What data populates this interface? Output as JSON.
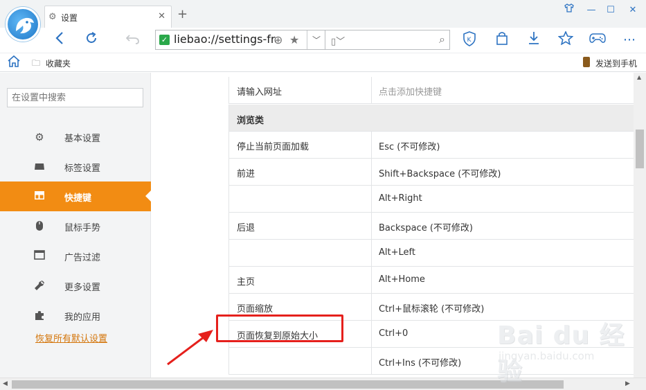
{
  "browser": {
    "tab_title": "设置",
    "tab_close": "✕",
    "new_tab": "+",
    "url": "liebao://settings-frame/shortcuts",
    "search_placeholder": "",
    "window_controls": [
      "shirt-icon",
      "minimize-icon",
      "maximize-icon",
      "close-icon"
    ]
  },
  "bookmarks": {
    "favorites_label": "收藏夹",
    "send_to_phone_label": "发送到手机"
  },
  "sidebar": {
    "search_placeholder": "在设置中搜索",
    "items": [
      {
        "label": "基本设置",
        "icon": "gear-icon"
      },
      {
        "label": "标签设置",
        "icon": "tab-icon"
      },
      {
        "label": "快捷键",
        "icon": "shortcut-icon",
        "active": true
      },
      {
        "label": "鼠标手势",
        "icon": "mouse-icon"
      },
      {
        "label": "广告过滤",
        "icon": "window-icon"
      },
      {
        "label": "更多设置",
        "icon": "wrench-icon"
      },
      {
        "label": "我的应用",
        "icon": "puzzle-icon"
      }
    ],
    "restore_defaults": "恢复所有默认设置"
  },
  "shortcuts": {
    "top_row": {
      "action": "请输入网址",
      "key": "点击添加快捷键"
    },
    "section_title": "浏览类",
    "rows": [
      {
        "action": "停止当前页面加载",
        "key": "Esc (不可修改)"
      },
      {
        "action": "前进",
        "key": "Shift+Backspace (不可修改)"
      },
      {
        "action": "",
        "key": "Alt+Right"
      },
      {
        "action": "后退",
        "key": "Backspace (不可修改)"
      },
      {
        "action": "",
        "key": "Alt+Left"
      },
      {
        "action": "主页",
        "key": "Alt+Home"
      },
      {
        "action": "页面缩放",
        "key": "Ctrl+鼠标滚轮 (不可修改)"
      },
      {
        "action": "页面恢复到原始大小",
        "key": "Ctrl+0"
      },
      {
        "action": "",
        "key": "Ctrl+Ins (不可修改)"
      }
    ]
  },
  "watermark": {
    "brand": "Bai du 经验",
    "site": "jingyan.baidu.com"
  },
  "colors": {
    "accent": "#f28c13",
    "link": "#d4760c",
    "toolbar_icon": "#2d73c2",
    "annotation": "#e5201c"
  }
}
